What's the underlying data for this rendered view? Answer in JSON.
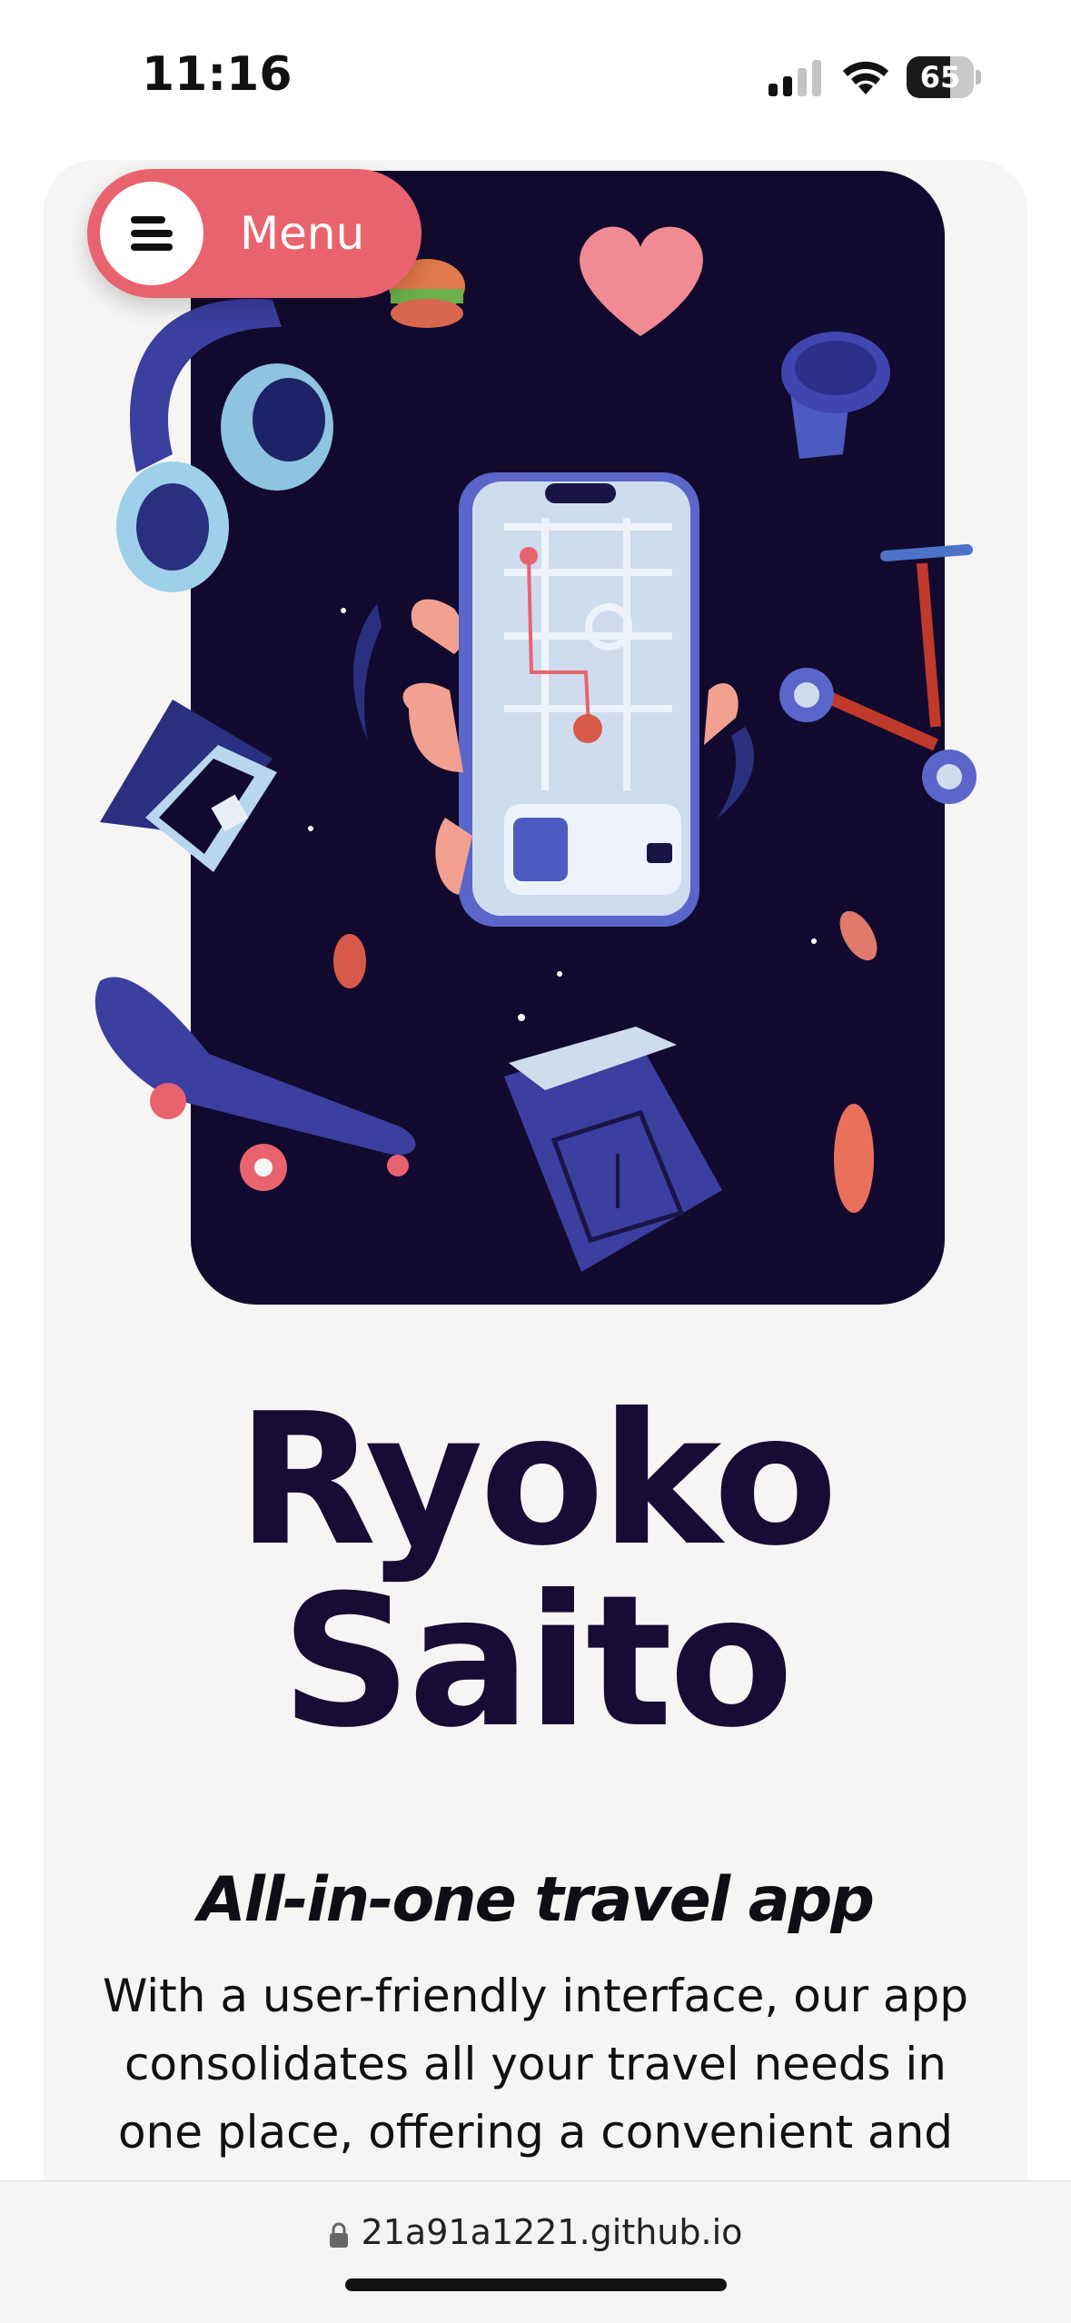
{
  "status_bar": {
    "time": "11:16",
    "battery_level": "65",
    "battery_fraction": 0.65
  },
  "menu": {
    "label": "Menu",
    "icon": "hamburger-icon",
    "color": "#e9636f"
  },
  "hero": {
    "background_color": "#120a2e",
    "illustration_items": [
      "headphones-icon",
      "burger-icon",
      "heart-icon",
      "coffee-cup-icon",
      "phone-map-icon",
      "scooter-icon",
      "laptop-icon",
      "skateboard-icon",
      "book-icon",
      "coin-icon"
    ]
  },
  "content": {
    "title_line1": "Ryoko",
    "title_line2": "Saito",
    "subtitle": "All-in-one travel app",
    "body": "With a user-friendly interface, our app consolidates all your travel needs in one place, offering a convenient and"
  },
  "browser": {
    "url": "21a91a1221.github.io"
  }
}
